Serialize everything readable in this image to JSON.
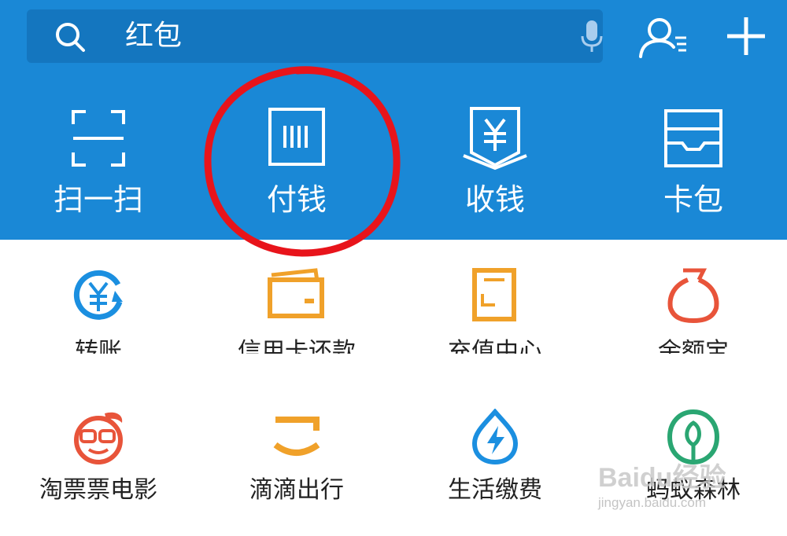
{
  "search": {
    "placeholder": "红包"
  },
  "top_actions": [
    {
      "label": "扫一扫",
      "icon": "scan-icon"
    },
    {
      "label": "付钱",
      "icon": "barcode-pay-icon"
    },
    {
      "label": "收钱",
      "icon": "receive-money-icon"
    },
    {
      "label": "卡包",
      "icon": "card-wallet-icon"
    }
  ],
  "grid_row1": [
    {
      "label": "转账",
      "icon": "transfer-icon"
    },
    {
      "label": "信用卡还款",
      "icon": "credit-card-icon"
    },
    {
      "label": "充值中心",
      "icon": "phone-topup-icon"
    },
    {
      "label": "余额宝",
      "icon": "yuebao-icon"
    }
  ],
  "grid_row2": [
    {
      "label": "淘票票电影",
      "icon": "taopiaopiao-icon"
    },
    {
      "label": "滴滴出行",
      "icon": "didi-icon"
    },
    {
      "label": "生活缴费",
      "icon": "utility-payment-icon"
    },
    {
      "label": "蚂蚁森林",
      "icon": "ant-forest-icon"
    }
  ],
  "colors": {
    "header_blue": "#1a88d6",
    "search_bg": "#1476bf",
    "highlight_red": "#e8141b",
    "transfer_blue": "#1b8fe0",
    "orange": "#f0a12a",
    "red_orange": "#e8543a",
    "green": "#2aa672"
  },
  "watermark": {
    "brand": "Baidu经验",
    "url": "jingyan.baidu.com"
  }
}
